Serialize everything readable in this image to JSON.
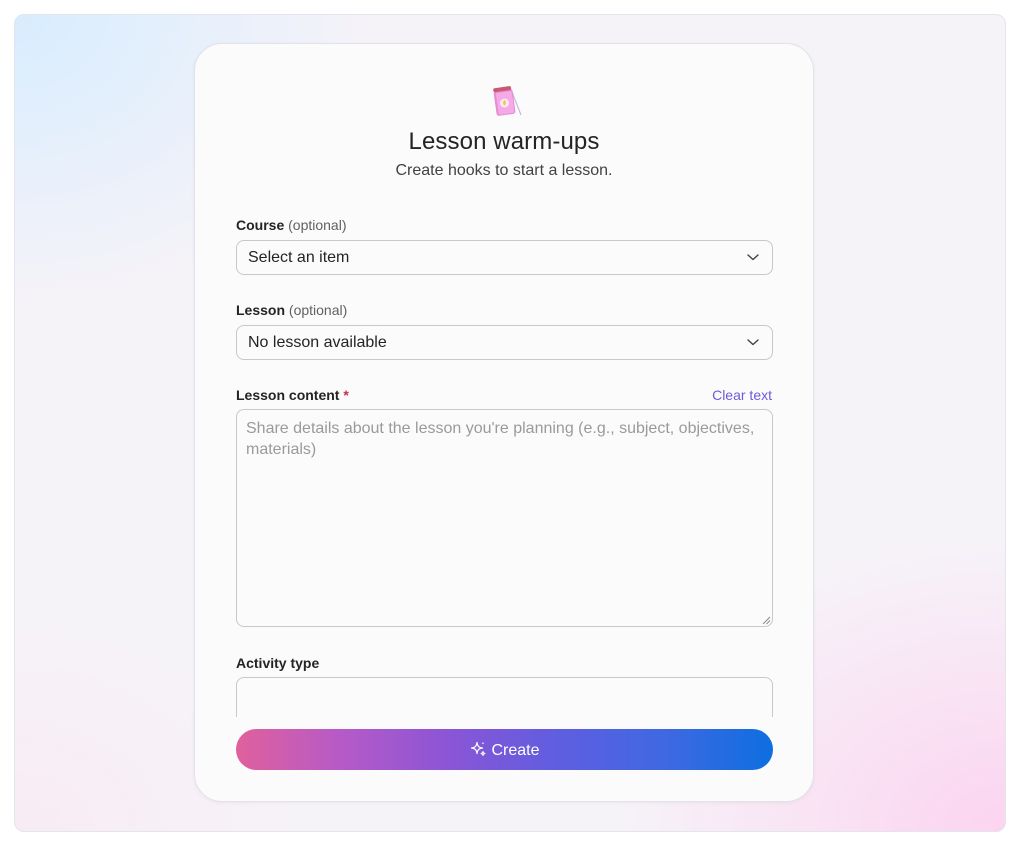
{
  "header": {
    "icon": "notebook-icon",
    "title": "Lesson warm-ups",
    "subtitle": "Create hooks to start a lesson."
  },
  "course": {
    "label": "Course",
    "optional": "(optional)",
    "value": "Select an item"
  },
  "lesson": {
    "label": "Lesson",
    "optional": "(optional)",
    "value": "No lesson available"
  },
  "lesson_content": {
    "label": "Lesson content",
    "required_mark": "*",
    "clear_label": "Clear text",
    "value": "",
    "placeholder": "Share details about the lesson you're planning (e.g., subject, objectives, materials)"
  },
  "activity_type": {
    "label": "Activity type"
  },
  "actions": {
    "create_label": "Create",
    "create_icon": "sparkle-icon"
  },
  "colors": {
    "accent_link": "#6f5ad8",
    "required": "#c4314b",
    "button_gradient_start": "#e0609c",
    "button_gradient_end": "#0d6fe0"
  }
}
